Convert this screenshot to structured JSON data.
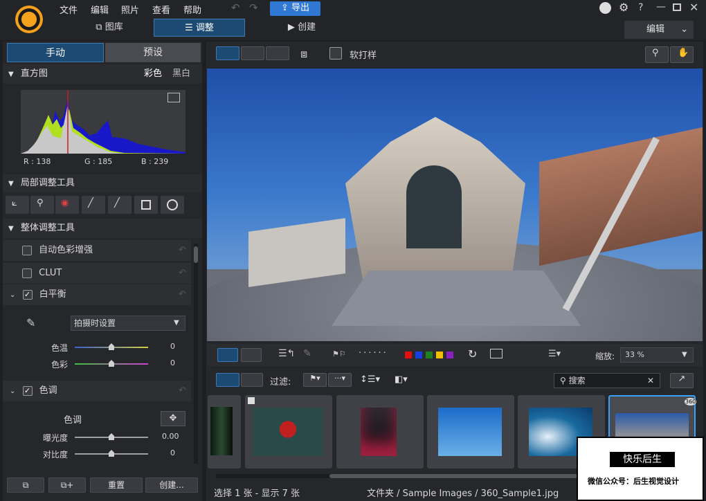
{
  "menu": {
    "file": "文件",
    "edit": "编辑",
    "photos": "照片",
    "view": "查看",
    "help": "帮助",
    "export": "导出"
  },
  "modes": {
    "library": "图库",
    "adjust": "调整",
    "create": "创建",
    "edit_dropdown": "编辑"
  },
  "left": {
    "tabs": {
      "manual": "手动",
      "preset": "预设"
    },
    "histogram": {
      "title": "直方图",
      "color": "彩色",
      "bw": "黑白",
      "r": "R : 138",
      "g": "G : 185",
      "b": "B : 239"
    },
    "local_tools": "局部调整工具",
    "global_tools": "整体调整工具",
    "auto_color": "自动色彩增强",
    "clut": "CLUT",
    "white_balance": {
      "title": "白平衡",
      "preset": "拍摄时设置",
      "temp_label": "色温",
      "temp_value": "0",
      "tint_label": "色彩",
      "tint_value": "0"
    },
    "tone": {
      "title": "色调",
      "section_label": "色调",
      "exposure_label": "曝光度",
      "exposure_value": "0.00",
      "contrast_label": "对比度",
      "contrast_value": "0"
    },
    "buttons": {
      "reset": "重置",
      "create": "创建..."
    }
  },
  "right": {
    "soft_proof": "软打样",
    "zoom_label": "缩放:",
    "zoom_value": "33 %",
    "filter_label": "过滤:",
    "search_placeholder": "搜索",
    "status_left": "选择 1 张 - 显示 7 张",
    "status_path": "文件夹 / Sample Images / 360_Sample1.jpg",
    "badge_360": "360",
    "color_labels": [
      "#e01010",
      "#1840e0",
      "#208020",
      "#f0c000",
      "#8a20c0"
    ]
  },
  "watermark": {
    "title": "快乐后生",
    "subtitle": "微信公众号：后生视觉设计"
  }
}
